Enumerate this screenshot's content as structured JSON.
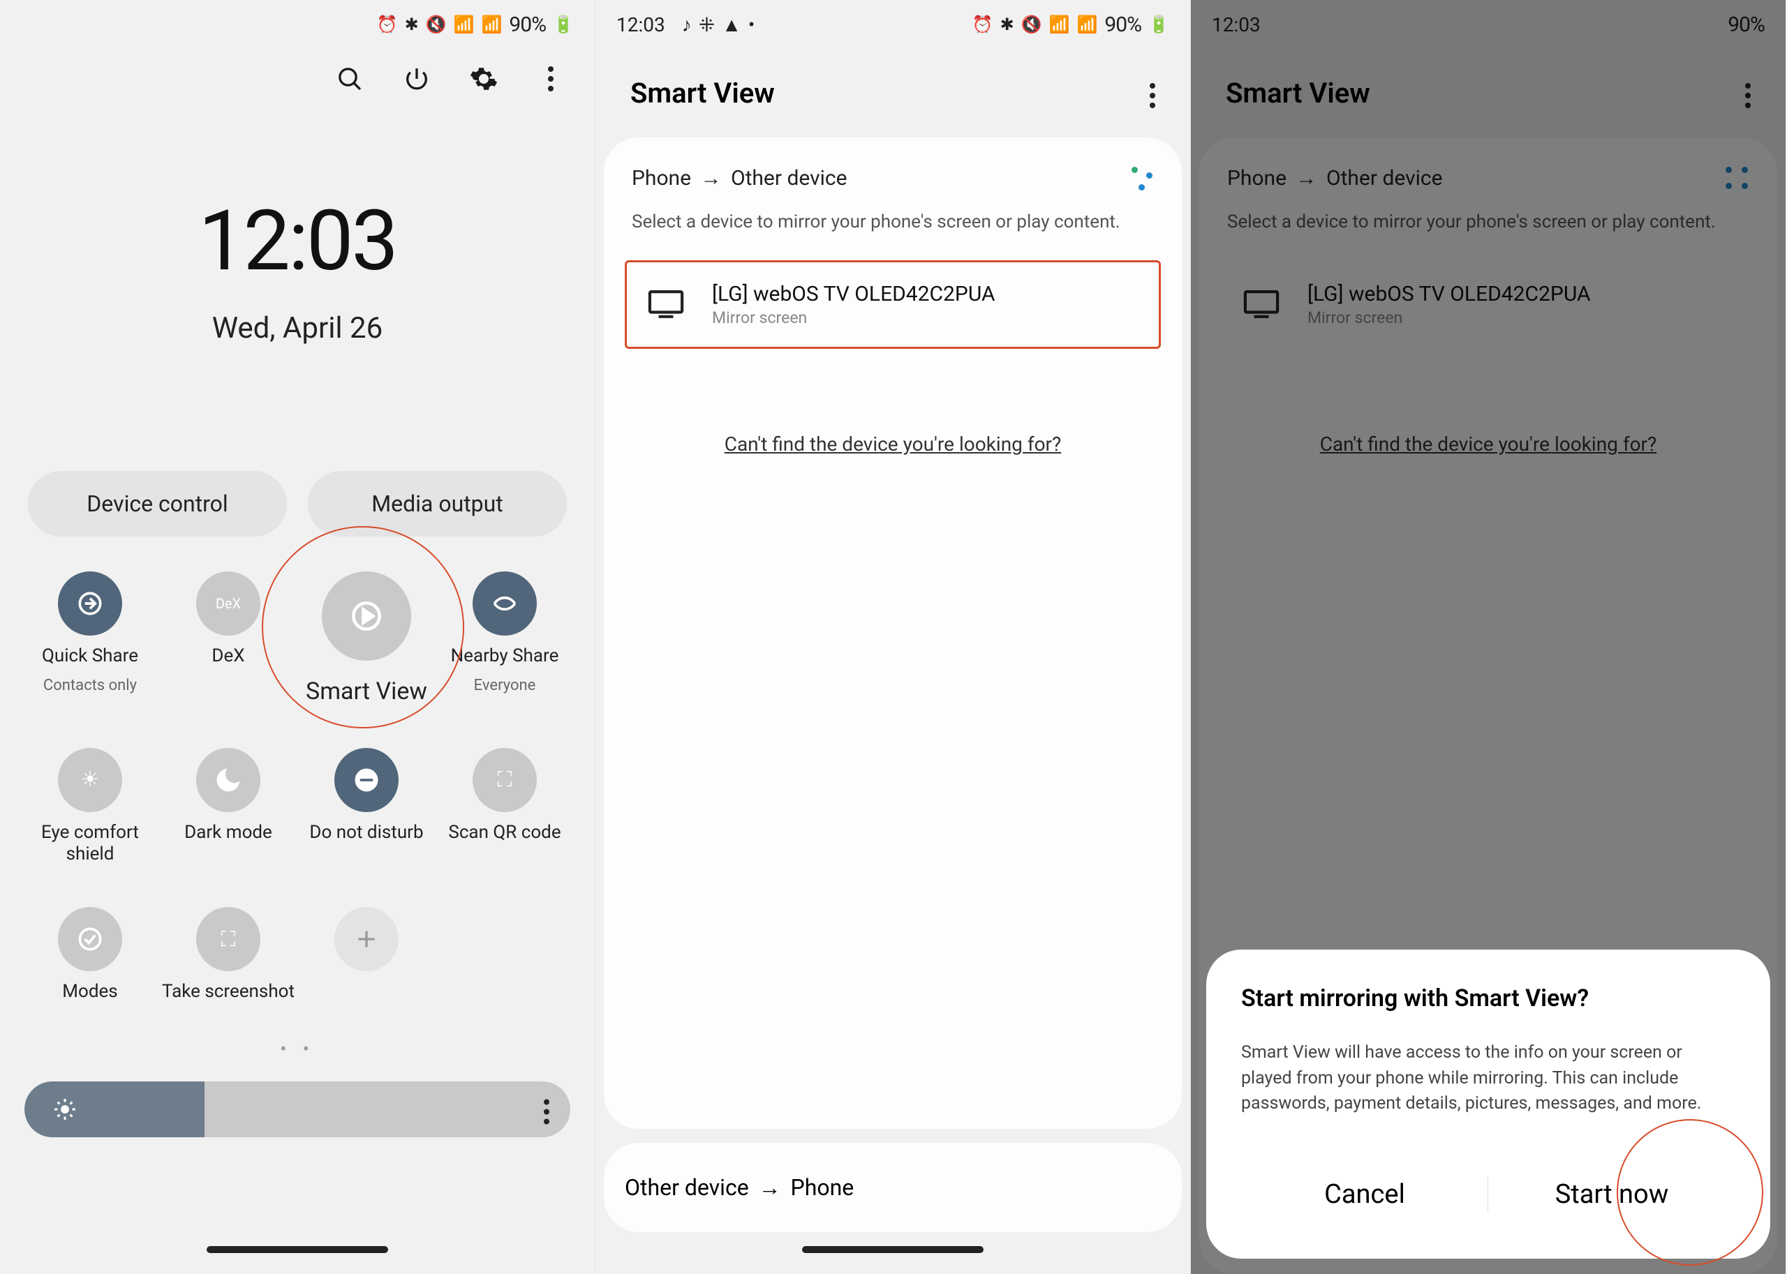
{
  "status": {
    "time": "12:03",
    "battery": "90%"
  },
  "panel1": {
    "clock": "12:03",
    "date": "Wed, April 26",
    "tabs": {
      "left": "Device control",
      "right": "Media output"
    },
    "tiles": {
      "quick_share": {
        "label": "Quick Share",
        "sub": "Contacts only"
      },
      "dex": {
        "label": "DeX",
        "sub": ""
      },
      "smart_view": {
        "label": "Smart View",
        "sub": ""
      },
      "nearby_share": {
        "label": "Nearby Share",
        "sub": "Everyone"
      },
      "eye_comfort": {
        "label": "Eye comfort shield",
        "sub": ""
      },
      "dark_mode": {
        "label": "Dark mode",
        "sub": ""
      },
      "dnd": {
        "label": "Do not disturb",
        "sub": ""
      },
      "scan_qr": {
        "label": "Scan QR code",
        "sub": ""
      },
      "modes": {
        "label": "Modes",
        "sub": ""
      },
      "screenshot": {
        "label": "Take screenshot",
        "sub": ""
      }
    }
  },
  "smartview": {
    "title": "Smart View",
    "direction_from": "Phone",
    "direction_to": "Other device",
    "hint": "Select a device to mirror your phone's screen or play content.",
    "device": {
      "name": "[LG] webOS TV OLED42C2PUA",
      "sub": "Mirror screen"
    },
    "help": "Can't find the device you're looking for?",
    "footer_from": "Other device",
    "footer_to": "Phone"
  },
  "dialog": {
    "title": "Start mirroring with Smart View?",
    "body": "Smart View will have access to the info on your screen or played from your phone while mirroring. This can include passwords, payment details, pictures, messages, and more.",
    "cancel": "Cancel",
    "confirm": "Start now"
  }
}
